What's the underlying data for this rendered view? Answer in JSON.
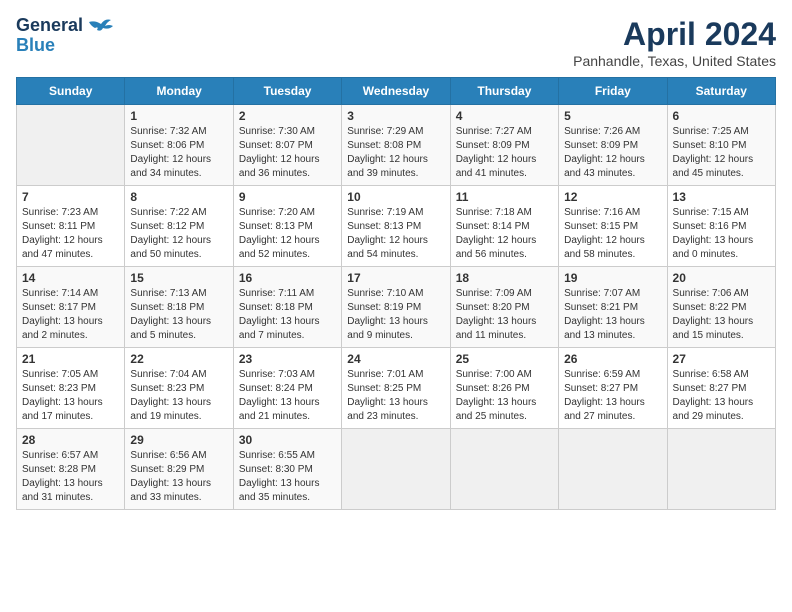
{
  "header": {
    "logo_line1": "General",
    "logo_line2": "Blue",
    "month": "April 2024",
    "location": "Panhandle, Texas, United States"
  },
  "weekdays": [
    "Sunday",
    "Monday",
    "Tuesday",
    "Wednesday",
    "Thursday",
    "Friday",
    "Saturday"
  ],
  "weeks": [
    [
      {
        "day": "",
        "detail": ""
      },
      {
        "day": "1",
        "detail": "Sunrise: 7:32 AM\nSunset: 8:06 PM\nDaylight: 12 hours\nand 34 minutes."
      },
      {
        "day": "2",
        "detail": "Sunrise: 7:30 AM\nSunset: 8:07 PM\nDaylight: 12 hours\nand 36 minutes."
      },
      {
        "day": "3",
        "detail": "Sunrise: 7:29 AM\nSunset: 8:08 PM\nDaylight: 12 hours\nand 39 minutes."
      },
      {
        "day": "4",
        "detail": "Sunrise: 7:27 AM\nSunset: 8:09 PM\nDaylight: 12 hours\nand 41 minutes."
      },
      {
        "day": "5",
        "detail": "Sunrise: 7:26 AM\nSunset: 8:09 PM\nDaylight: 12 hours\nand 43 minutes."
      },
      {
        "day": "6",
        "detail": "Sunrise: 7:25 AM\nSunset: 8:10 PM\nDaylight: 12 hours\nand 45 minutes."
      }
    ],
    [
      {
        "day": "7",
        "detail": "Sunrise: 7:23 AM\nSunset: 8:11 PM\nDaylight: 12 hours\nand 47 minutes."
      },
      {
        "day": "8",
        "detail": "Sunrise: 7:22 AM\nSunset: 8:12 PM\nDaylight: 12 hours\nand 50 minutes."
      },
      {
        "day": "9",
        "detail": "Sunrise: 7:20 AM\nSunset: 8:13 PM\nDaylight: 12 hours\nand 52 minutes."
      },
      {
        "day": "10",
        "detail": "Sunrise: 7:19 AM\nSunset: 8:13 PM\nDaylight: 12 hours\nand 54 minutes."
      },
      {
        "day": "11",
        "detail": "Sunrise: 7:18 AM\nSunset: 8:14 PM\nDaylight: 12 hours\nand 56 minutes."
      },
      {
        "day": "12",
        "detail": "Sunrise: 7:16 AM\nSunset: 8:15 PM\nDaylight: 12 hours\nand 58 minutes."
      },
      {
        "day": "13",
        "detail": "Sunrise: 7:15 AM\nSunset: 8:16 PM\nDaylight: 13 hours\nand 0 minutes."
      }
    ],
    [
      {
        "day": "14",
        "detail": "Sunrise: 7:14 AM\nSunset: 8:17 PM\nDaylight: 13 hours\nand 2 minutes."
      },
      {
        "day": "15",
        "detail": "Sunrise: 7:13 AM\nSunset: 8:18 PM\nDaylight: 13 hours\nand 5 minutes."
      },
      {
        "day": "16",
        "detail": "Sunrise: 7:11 AM\nSunset: 8:18 PM\nDaylight: 13 hours\nand 7 minutes."
      },
      {
        "day": "17",
        "detail": "Sunrise: 7:10 AM\nSunset: 8:19 PM\nDaylight: 13 hours\nand 9 minutes."
      },
      {
        "day": "18",
        "detail": "Sunrise: 7:09 AM\nSunset: 8:20 PM\nDaylight: 13 hours\nand 11 minutes."
      },
      {
        "day": "19",
        "detail": "Sunrise: 7:07 AM\nSunset: 8:21 PM\nDaylight: 13 hours\nand 13 minutes."
      },
      {
        "day": "20",
        "detail": "Sunrise: 7:06 AM\nSunset: 8:22 PM\nDaylight: 13 hours\nand 15 minutes."
      }
    ],
    [
      {
        "day": "21",
        "detail": "Sunrise: 7:05 AM\nSunset: 8:23 PM\nDaylight: 13 hours\nand 17 minutes."
      },
      {
        "day": "22",
        "detail": "Sunrise: 7:04 AM\nSunset: 8:23 PM\nDaylight: 13 hours\nand 19 minutes."
      },
      {
        "day": "23",
        "detail": "Sunrise: 7:03 AM\nSunset: 8:24 PM\nDaylight: 13 hours\nand 21 minutes."
      },
      {
        "day": "24",
        "detail": "Sunrise: 7:01 AM\nSunset: 8:25 PM\nDaylight: 13 hours\nand 23 minutes."
      },
      {
        "day": "25",
        "detail": "Sunrise: 7:00 AM\nSunset: 8:26 PM\nDaylight: 13 hours\nand 25 minutes."
      },
      {
        "day": "26",
        "detail": "Sunrise: 6:59 AM\nSunset: 8:27 PM\nDaylight: 13 hours\nand 27 minutes."
      },
      {
        "day": "27",
        "detail": "Sunrise: 6:58 AM\nSunset: 8:27 PM\nDaylight: 13 hours\nand 29 minutes."
      }
    ],
    [
      {
        "day": "28",
        "detail": "Sunrise: 6:57 AM\nSunset: 8:28 PM\nDaylight: 13 hours\nand 31 minutes."
      },
      {
        "day": "29",
        "detail": "Sunrise: 6:56 AM\nSunset: 8:29 PM\nDaylight: 13 hours\nand 33 minutes."
      },
      {
        "day": "30",
        "detail": "Sunrise: 6:55 AM\nSunset: 8:30 PM\nDaylight: 13 hours\nand 35 minutes."
      },
      {
        "day": "",
        "detail": ""
      },
      {
        "day": "",
        "detail": ""
      },
      {
        "day": "",
        "detail": ""
      },
      {
        "day": "",
        "detail": ""
      }
    ]
  ]
}
